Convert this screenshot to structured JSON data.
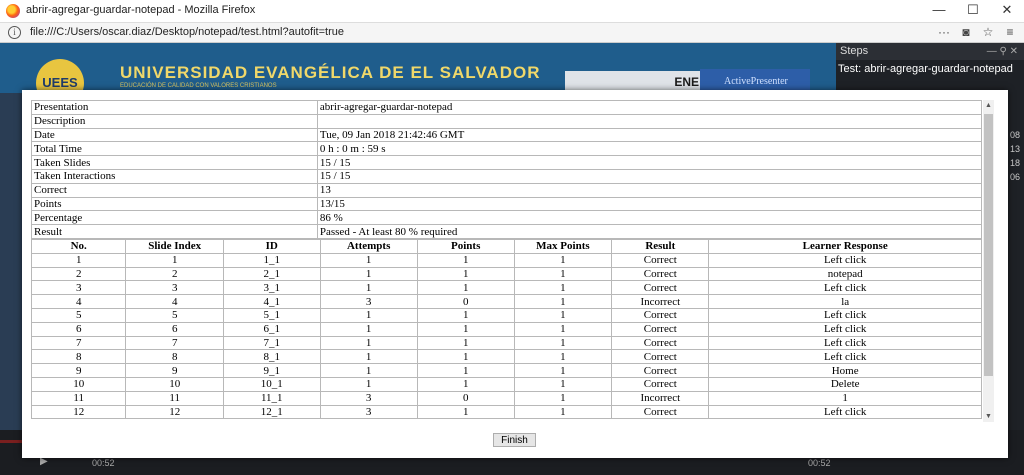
{
  "window": {
    "title": "abrir-agregar-guardar-notepad - Mozilla Firefox",
    "minimize": "—",
    "maximize": "☐",
    "close": "✕"
  },
  "urlbar": {
    "url": "file:///C:/Users/oscar.diaz/Desktop/notepad/test.html?autofit=true",
    "info_icon": "info-icon",
    "menu_icon": "more-icon",
    "pocket_icon": "pocket-icon",
    "star_icon": "star-icon"
  },
  "background": {
    "logo_text": "UEES",
    "university": "UNIVERSIDAD EVANGÉLICA DE EL SALVADOR",
    "slogan": "EDUCACIÓN DE CALIDAD CON VALORES CRISTIANOS",
    "partial_tab": "ENE",
    "activepresenter": "ActivePresenter"
  },
  "steps_panel": {
    "title": "Steps",
    "controls": "— ⚲ ✕",
    "test_label": "Test: abrir-agregar-guardar-notepad",
    "times": [
      "08",
      "13",
      "18",
      "06"
    ]
  },
  "timeline": {
    "current": "00:52",
    "end": "00:52"
  },
  "summary": [
    {
      "label": "Presentation",
      "value": "abrir-agregar-guardar-notepad"
    },
    {
      "label": "Description",
      "value": ""
    },
    {
      "label": "Date",
      "value": "Tue, 09 Jan 2018 21:42:46 GMT"
    },
    {
      "label": "Total Time",
      "value": "0 h : 0 m : 59 s"
    },
    {
      "label": "Taken Slides",
      "value": "15 / 15"
    },
    {
      "label": "Taken Interactions",
      "value": "15 / 15"
    },
    {
      "label": "Correct",
      "value": "13"
    },
    {
      "label": "Points",
      "value": "13/15"
    },
    {
      "label": "Percentage",
      "value": "86 %"
    },
    {
      "label": "Result",
      "value": "Passed - At least 80 % required"
    }
  ],
  "columns": [
    "No.",
    "Slide Index",
    "ID",
    "Attempts",
    "Points",
    "Max Points",
    "Result",
    "Learner Response"
  ],
  "rows": [
    [
      "1",
      "1",
      "1_1",
      "1",
      "1",
      "1",
      "Correct",
      "Left click"
    ],
    [
      "2",
      "2",
      "2_1",
      "1",
      "1",
      "1",
      "Correct",
      "notepad"
    ],
    [
      "3",
      "3",
      "3_1",
      "1",
      "1",
      "1",
      "Correct",
      "Left click"
    ],
    [
      "4",
      "4",
      "4_1",
      "3",
      "0",
      "1",
      "Incorrect",
      "la"
    ],
    [
      "5",
      "5",
      "5_1",
      "1",
      "1",
      "1",
      "Correct",
      "Left click"
    ],
    [
      "6",
      "6",
      "6_1",
      "1",
      "1",
      "1",
      "Correct",
      "Left click"
    ],
    [
      "7",
      "7",
      "7_1",
      "1",
      "1",
      "1",
      "Correct",
      "Left click"
    ],
    [
      "8",
      "8",
      "8_1",
      "1",
      "1",
      "1",
      "Correct",
      "Left click"
    ],
    [
      "9",
      "9",
      "9_1",
      "1",
      "1",
      "1",
      "Correct",
      "Home"
    ],
    [
      "10",
      "10",
      "10_1",
      "1",
      "1",
      "1",
      "Correct",
      "Delete"
    ],
    [
      "11",
      "11",
      "11_1",
      "3",
      "0",
      "1",
      "Incorrect",
      "1"
    ],
    [
      "12",
      "12",
      "12_1",
      "3",
      "1",
      "1",
      "Correct",
      "Left click"
    ]
  ],
  "finish_label": "Finish"
}
